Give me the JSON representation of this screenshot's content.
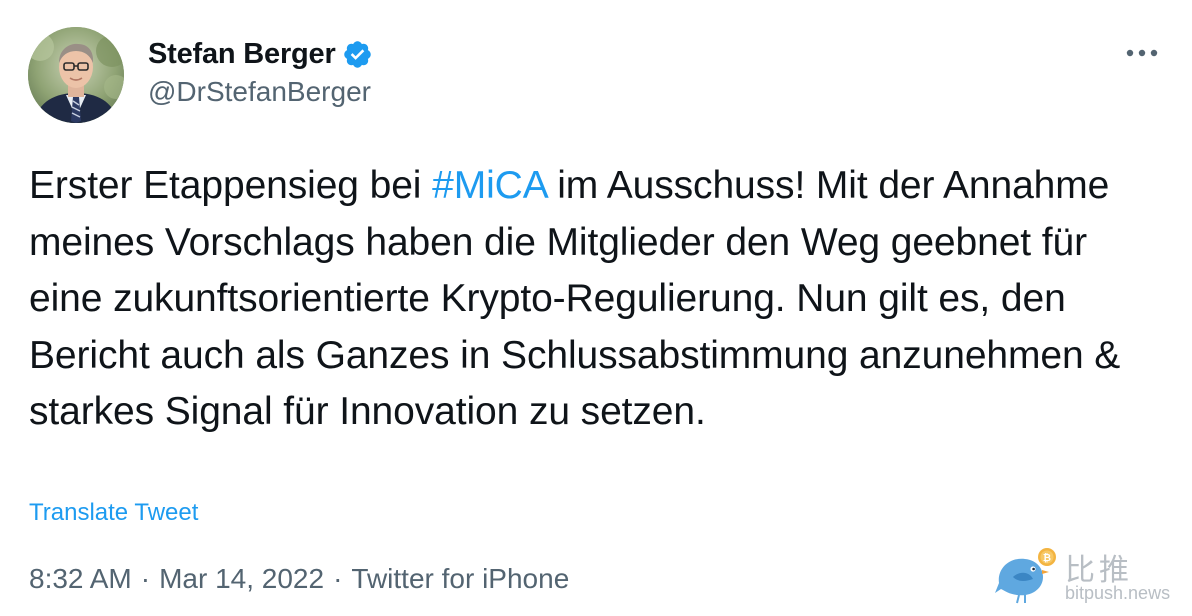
{
  "author": {
    "name": "Stefan Berger",
    "handle": "@DrStefanBerger",
    "verified": true
  },
  "tweet": {
    "segments": [
      "Erster Etappensieg bei ",
      "#MiCA",
      " im Ausschuss! Mit der Annahme meines Vorschlags haben die Mitglieder den Weg geebnet für eine zukunftsorientierte Krypto-Regulierung. Nun gilt es, den Bericht auch als Ganzes in Schlussabstimmung anzunehmen & starkes Signal für Innovation zu setzen."
    ],
    "translate_label": "Translate Tweet"
  },
  "meta": {
    "time": "8:32 AM",
    "separator": "·",
    "date": "Mar 14, 2022",
    "source": "Twitter for iPhone"
  },
  "watermark": {
    "brand_cn": "比推",
    "domain": "bitpush.news"
  },
  "colors": {
    "link": "#1d9bf0",
    "text": "#0f1419",
    "muted": "#536471",
    "watermark": "#b8bec4"
  },
  "icons": {
    "verified": "verified-badge-icon",
    "more": "more-dots-icon",
    "watermark_logo": "bird-coin-icon"
  }
}
